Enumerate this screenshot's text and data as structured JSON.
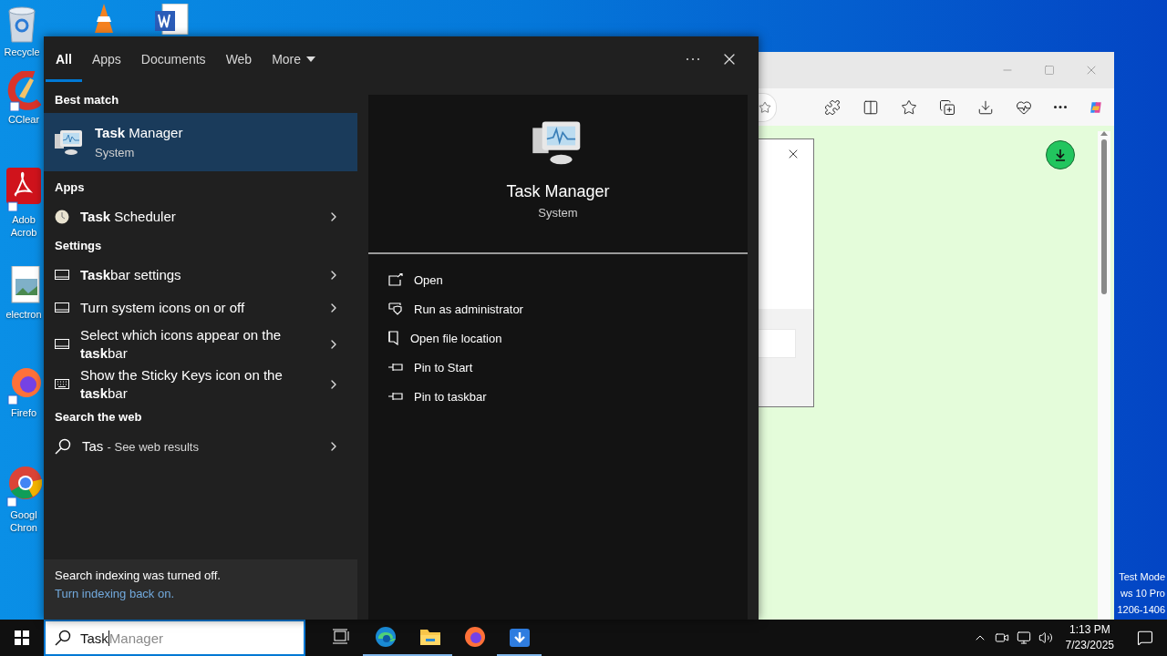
{
  "desktop": {
    "icons": [
      {
        "kind": "recycle",
        "label": "Recycle"
      },
      {
        "kind": "vlc"
      },
      {
        "kind": "word"
      },
      {
        "kind": "ccleaner",
        "label": "CClear"
      },
      {
        "kind": "acrobat",
        "label": "Adob Acrob"
      },
      {
        "kind": "image",
        "label": "electron"
      },
      {
        "kind": "firefox",
        "label": "Firefo"
      },
      {
        "kind": "chrome",
        "label": "Googl Chron"
      }
    ],
    "notice_lines": [
      "Test Mode",
      "ws 10 Pro",
      "1206-1406"
    ]
  },
  "search_flyout": {
    "tabs": [
      {
        "label": "All",
        "selected": true,
        "has_menu": false
      },
      {
        "label": "Apps",
        "selected": false,
        "has_menu": false
      },
      {
        "label": "Documents",
        "selected": false,
        "has_menu": false
      },
      {
        "label": "Web",
        "selected": false,
        "has_menu": false
      },
      {
        "label": "More",
        "selected": false,
        "has_menu": true
      }
    ],
    "sections": [
      {
        "heading": "Best match",
        "results": [
          {
            "kind": "best",
            "title": "**Task** Manager",
            "subtitle": "System",
            "selected": true
          }
        ]
      },
      {
        "heading": "Apps",
        "results": [
          {
            "kind": "app",
            "title": "**Task** Scheduler",
            "selected": false
          }
        ]
      },
      {
        "heading": "Settings",
        "results": [
          {
            "kind": "setting",
            "title": "**Task**bar settings",
            "selected": false
          },
          {
            "kind": "setting",
            "title": "Turn system icons on or off",
            "selected": false
          },
          {
            "kind": "setting",
            "title": "Select which icons appear on the **task**bar",
            "selected": false
          },
          {
            "kind": "keyboard",
            "title": "Show the Sticky Keys icon on the **task**bar",
            "selected": false
          }
        ]
      },
      {
        "heading": "Search the web",
        "results": [
          {
            "kind": "web",
            "title": "Tas",
            "note": "- See web results",
            "selected": false
          }
        ]
      }
    ],
    "footer": {
      "message": "Search indexing was turned off.",
      "link": "Turn indexing back on."
    },
    "preview": {
      "title": "Task Manager",
      "subtitle": "System",
      "actions": [
        {
          "label": "Open"
        },
        {
          "label": "Run as administrator"
        },
        {
          "label": "Open file location"
        },
        {
          "label": "Pin to Start"
        },
        {
          "label": "Pin to taskbar"
        }
      ]
    }
  },
  "taskbar": {
    "search": {
      "value": "Task",
      "completion": "Manager"
    },
    "apps": [
      {
        "kind": "taskview",
        "running": false
      },
      {
        "kind": "edge",
        "running": true
      },
      {
        "kind": "explorer",
        "running": true
      },
      {
        "kind": "firefox",
        "running": false
      },
      {
        "kind": "downloader",
        "running": true
      }
    ],
    "clock": {
      "time": "1:13 PM",
      "date": "7/23/2025"
    }
  }
}
